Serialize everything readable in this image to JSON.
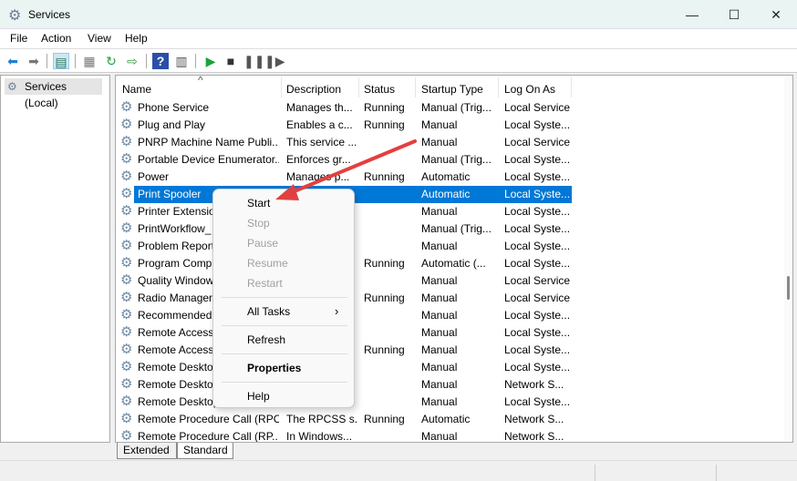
{
  "window": {
    "title": "Services",
    "icon": "gear-icon",
    "controls": [
      "minimize",
      "maximize",
      "close"
    ]
  },
  "menu": [
    "File",
    "Action",
    "View",
    "Help"
  ],
  "toolbar": {
    "icons": [
      "back-arrow-icon",
      "forward-arrow-icon",
      "show-hide-console-tree-icon",
      "properties-icon",
      "refresh-icon",
      "export-list-icon",
      "help-icon",
      "show-action-pane-icon",
      "start-service-icon",
      "stop-service-icon",
      "pause-service-icon",
      "resume-service-icon"
    ]
  },
  "tree": {
    "root": "Services (Local)"
  },
  "columns": [
    "Name",
    "Description",
    "Status",
    "Startup Type",
    "Log On As"
  ],
  "rows": [
    {
      "name": "Phone Service",
      "description": "Manages th...",
      "status": "Running",
      "startup": "Manual (Trig...",
      "logon": "Local Service"
    },
    {
      "name": "Plug and Play",
      "description": "Enables a c...",
      "status": "Running",
      "startup": "Manual",
      "logon": "Local Syste..."
    },
    {
      "name": "PNRP Machine Name Publi...",
      "description": "This service ...",
      "status": "",
      "startup": "Manual",
      "logon": "Local Service"
    },
    {
      "name": "Portable Device Enumerator...",
      "description": "Enforces gr...",
      "status": "",
      "startup": "Manual (Trig...",
      "logon": "Local Syste..."
    },
    {
      "name": "Power",
      "description": "Manages p...",
      "status": "Running",
      "startup": "Automatic",
      "logon": "Local Syste..."
    },
    {
      "name": "Print Spooler",
      "description": "",
      "status": "",
      "startup": "Automatic",
      "logon": "Local Syste...",
      "selected": true
    },
    {
      "name": "Printer Extensio",
      "description": "",
      "status": "",
      "startup": "Manual",
      "logon": "Local Syste..."
    },
    {
      "name": "PrintWorkflow_",
      "description": "",
      "status": "",
      "startup": "Manual (Trig...",
      "logon": "Local Syste..."
    },
    {
      "name": "Problem Report",
      "description": "",
      "status": "",
      "startup": "Manual",
      "logon": "Local Syste..."
    },
    {
      "name": "Program Comp",
      "description": "",
      "status": "Running",
      "startup": "Automatic (...",
      "logon": "Local Syste..."
    },
    {
      "name": "Quality Window",
      "description": "",
      "status": "",
      "startup": "Manual",
      "logon": "Local Service"
    },
    {
      "name": "Radio Managem",
      "description": "",
      "status": "Running",
      "startup": "Manual",
      "logon": "Local Service"
    },
    {
      "name": "Recommended",
      "description": "",
      "status": "",
      "startup": "Manual",
      "logon": "Local Syste..."
    },
    {
      "name": "Remote Access",
      "description": "",
      "status": "",
      "startup": "Manual",
      "logon": "Local Syste..."
    },
    {
      "name": "Remote Access",
      "description": "",
      "status": "Running",
      "startup": "Manual",
      "logon": "Local Syste..."
    },
    {
      "name": "Remote Desktop",
      "description": "",
      "status": "",
      "startup": "Manual",
      "logon": "Local Syste..."
    },
    {
      "name": "Remote Desktop",
      "description": "",
      "status": "",
      "startup": "Manual",
      "logon": "Network S..."
    },
    {
      "name": "Remote Desktop",
      "description": "",
      "status": "",
      "startup": "Manual",
      "logon": "Local Syste..."
    },
    {
      "name": "Remote Procedure Call (RPC)",
      "description": "The RPCSS s...",
      "status": "Running",
      "startup": "Automatic",
      "logon": "Network S..."
    },
    {
      "name": "Remote Procedure Call (RP...",
      "description": "In Windows...",
      "status": "",
      "startup": "Manual",
      "logon": "Network S..."
    }
  ],
  "tabs": [
    "Extended",
    "Standard"
  ],
  "context_menu": {
    "start": "Start",
    "stop": "Stop",
    "pause": "Pause",
    "resume": "Resume",
    "restart": "Restart",
    "all_tasks": "All Tasks",
    "refresh": "Refresh",
    "properties": "Properties",
    "help": "Help"
  },
  "colors": {
    "selection": "#0078d7",
    "annotation_arrow": "#e2403f"
  }
}
